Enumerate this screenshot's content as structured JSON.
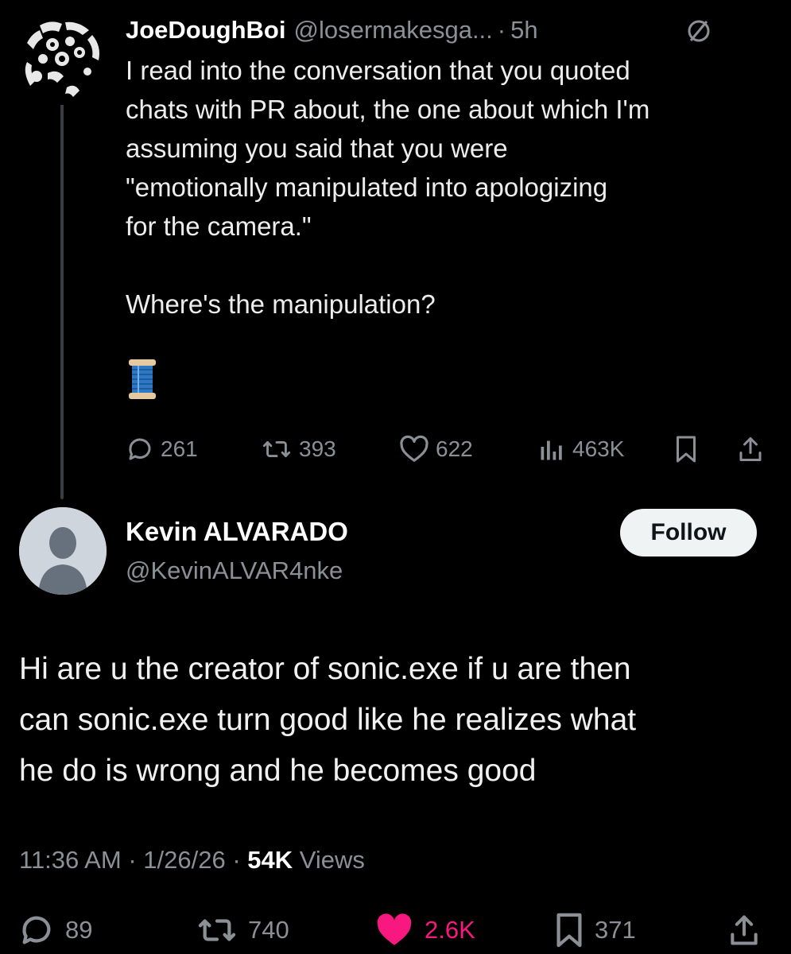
{
  "quoted_tweet": {
    "display_name": "JoeDoughBoi",
    "handle": "@losermakesga...",
    "separator": "·",
    "time": "5h",
    "text": "I read into the conversation that you quoted\nchats with PR about, the one about which I'm\nassuming you said that you were\n\"emotionally manipulated into apologizing\nfor the camera.\"\n\nWhere's the manipulation?",
    "emoji_icon": "spool-of-thread-icon",
    "actions": {
      "replies": "261",
      "reposts": "393",
      "likes": "622",
      "views": "463K"
    }
  },
  "main_tweet": {
    "display_name": "Kevin ALVARADO",
    "handle": "@KevinALVAR4nke",
    "follow_label": "Follow",
    "text": "Hi are u the creator of sonic.exe if u are then\ncan sonic.exe turn good like he realizes what\nhe do is wrong and he becomes good",
    "meta": {
      "time": "11:36 AM",
      "separator": "·",
      "date": "1/26/26",
      "views_count": "54K",
      "views_label": "Views"
    },
    "actions": {
      "replies": "89",
      "reposts": "740",
      "likes": "2.6K",
      "bookmarks": "371"
    }
  },
  "colors": {
    "background": "#000000",
    "text_primary": "#e7e9ea",
    "text_secondary": "#8b9096",
    "like_active": "#f91880",
    "follow_button_bg": "#eff3f4",
    "thread_line": "#3a3d41"
  }
}
